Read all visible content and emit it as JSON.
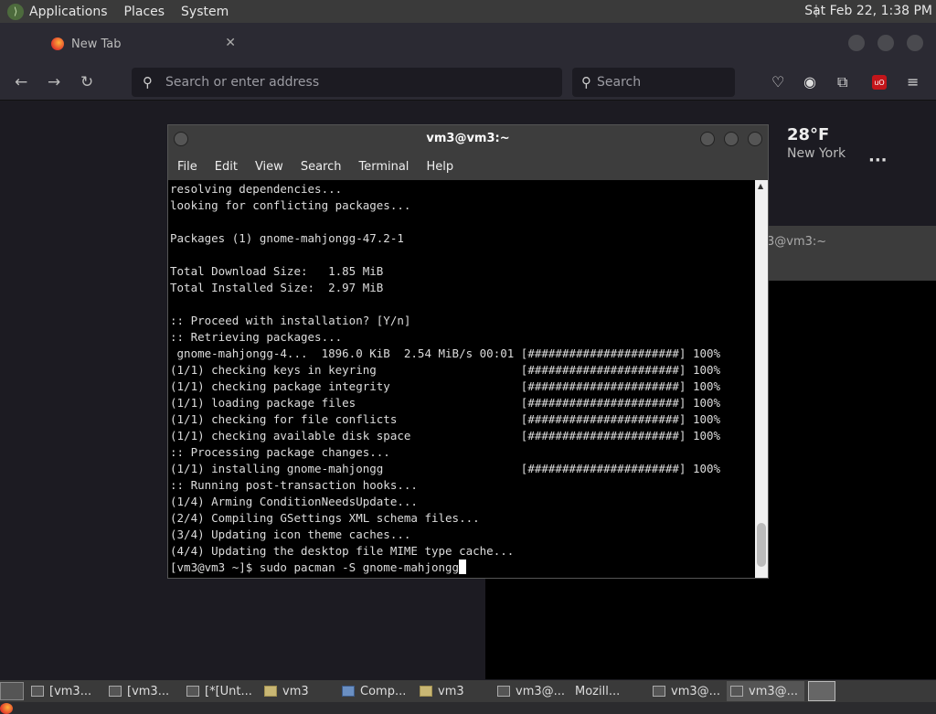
{
  "topbar": {
    "menus": [
      "Applications",
      "Places",
      "System"
    ],
    "clock": "Sat Feb 22, 1:38 PM"
  },
  "browser": {
    "tab_title": "New Tab",
    "url_placeholder": "Search or enter address",
    "search_placeholder": "Search",
    "weather_temp": "28°F",
    "weather_city": "New York"
  },
  "bg_terminal": {
    "title": "3@vm3:~"
  },
  "terminal": {
    "title": "vm3@vm3:~",
    "menu": [
      "File",
      "Edit",
      "View",
      "Search",
      "Terminal",
      "Help"
    ],
    "lines": [
      "resolving dependencies...",
      "looking for conflicting packages...",
      "",
      "Packages (1) gnome-mahjongg-47.2-1",
      "",
      "Total Download Size:   1.85 MiB",
      "Total Installed Size:  2.97 MiB",
      "",
      ":: Proceed with installation? [Y/n]",
      ":: Retrieving packages...",
      " gnome-mahjongg-4...  1896.0 KiB  2.54 MiB/s 00:01 [######################] 100%",
      "(1/1) checking keys in keyring                     [######################] 100%",
      "(1/1) checking package integrity                   [######################] 100%",
      "(1/1) loading package files                        [######################] 100%",
      "(1/1) checking for file conflicts                  [######################] 100%",
      "(1/1) checking available disk space                [######################] 100%",
      ":: Processing package changes...",
      "(1/1) installing gnome-mahjongg                    [######################] 100%",
      ":: Running post-transaction hooks...",
      "(1/4) Arming ConditionNeedsUpdate...",
      "(2/4) Compiling GSettings XML schema files...",
      "(3/4) Updating icon theme caches...",
      "(4/4) Updating the desktop file MIME type cache..."
    ],
    "prompt": "[vm3@vm3 ~]$ sudo pacman -S gnome-mahjongg"
  },
  "taskbar": {
    "items": [
      {
        "label": "[vm3...",
        "icon": "terminal"
      },
      {
        "label": "[vm3...",
        "icon": "terminal"
      },
      {
        "label": "[*[Unt...",
        "icon": "editor"
      },
      {
        "label": "vm3",
        "icon": "folder"
      },
      {
        "label": "Comp...",
        "icon": "computer"
      },
      {
        "label": "vm3",
        "icon": "folder"
      },
      {
        "label": "vm3@...",
        "icon": "terminal"
      },
      {
        "label": "Mozill...",
        "icon": "firefox"
      },
      {
        "label": "vm3@...",
        "icon": "terminal"
      },
      {
        "label": "vm3@...",
        "icon": "terminal"
      }
    ]
  }
}
